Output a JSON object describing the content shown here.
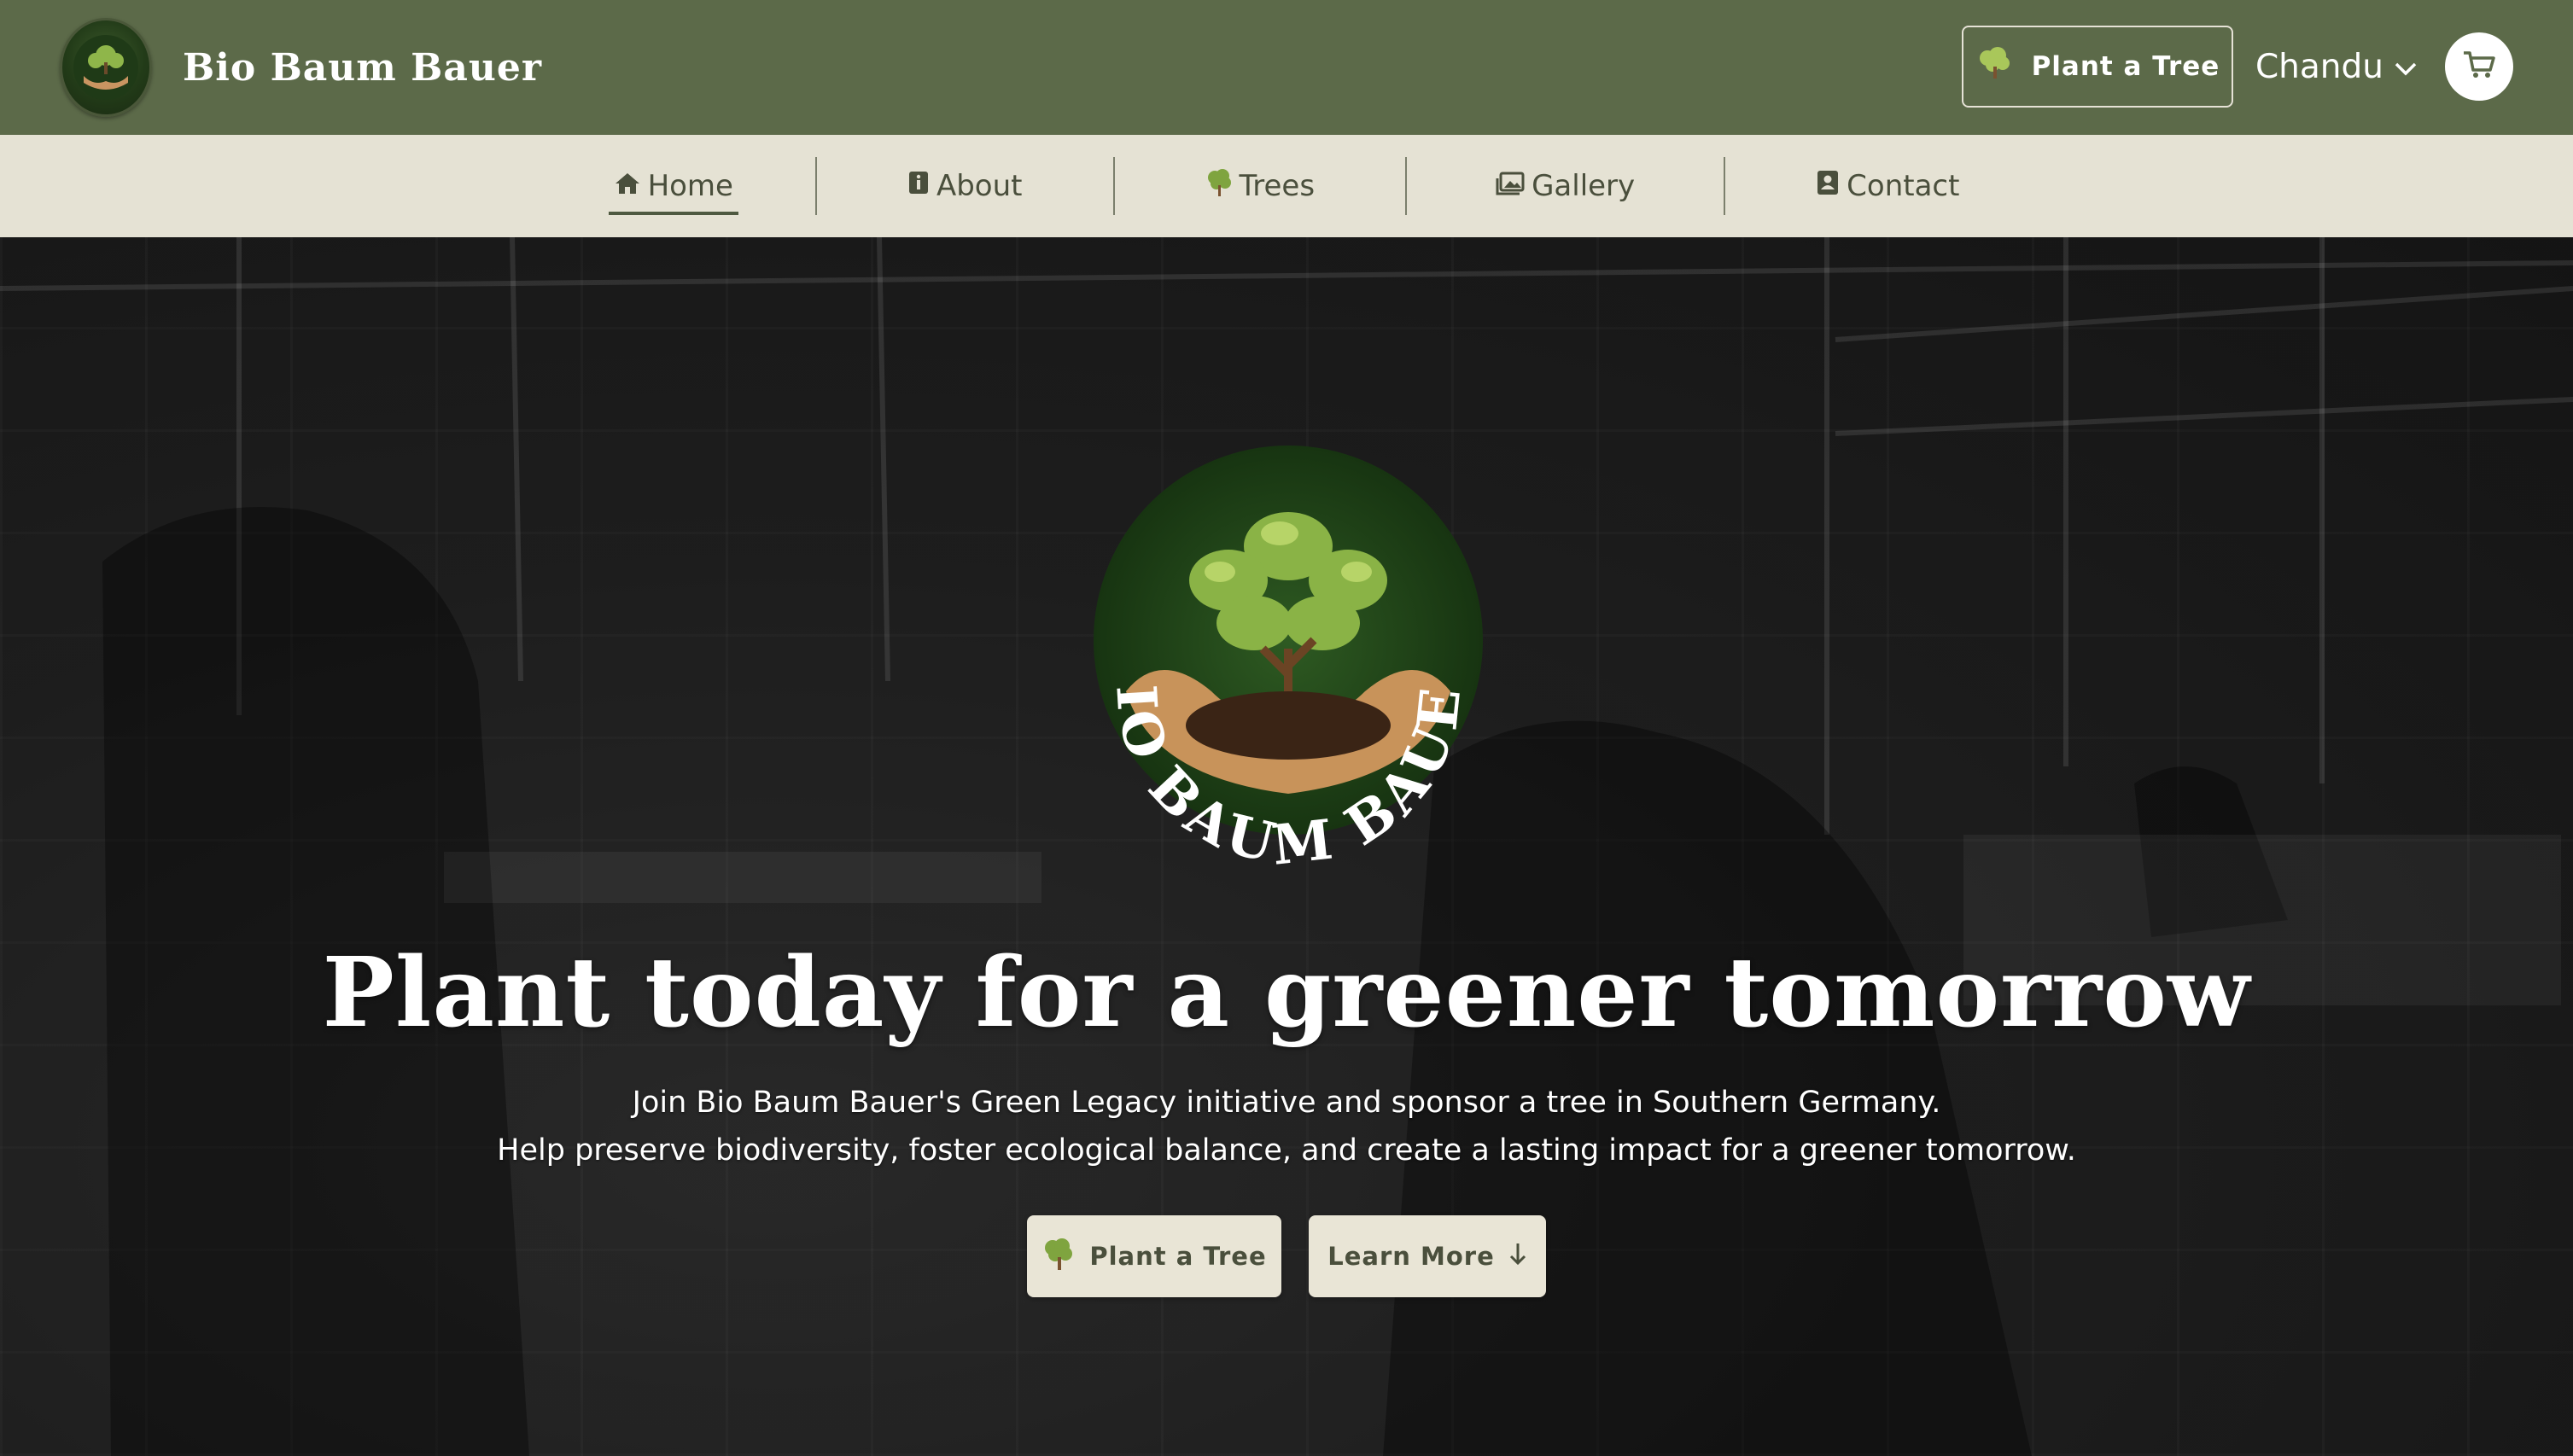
{
  "brand": {
    "name": "Bio Baum Bauer",
    "logo_text": "BIO BAUM BAUER"
  },
  "header": {
    "plant_button": "Plant a Tree",
    "user_name": "Chandu",
    "icons": [
      "tree-icon",
      "chevron-down-icon",
      "cart-icon"
    ]
  },
  "nav": {
    "items": [
      {
        "label": "Home",
        "icon": "home-icon",
        "active": true
      },
      {
        "label": "About",
        "icon": "info-icon",
        "active": false
      },
      {
        "label": "Trees",
        "icon": "tree-icon",
        "active": false
      },
      {
        "label": "Gallery",
        "icon": "images-icon",
        "active": false
      },
      {
        "label": "Contact",
        "icon": "contact-icon",
        "active": false
      }
    ]
  },
  "hero": {
    "title": "Plant today for a greener tomorrow",
    "subtitle_line1": "Join Bio Baum Bauer's Green Legacy initiative and sponsor a tree in Southern Germany.",
    "subtitle_line2": "Help preserve biodiversity, foster ecological balance, and create a lasting impact for a greener tomorrow.",
    "primary_button": "Plant a Tree",
    "secondary_button": "Learn More"
  },
  "colors": {
    "header_bg": "#5c6a49",
    "nav_bg": "#e5e2d4",
    "button_bg": "#e9e5d6",
    "text_dark": "#4a4f3c"
  }
}
